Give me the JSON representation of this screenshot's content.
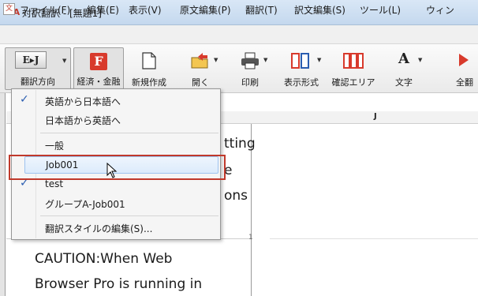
{
  "window": {
    "logo": "TA",
    "title": "対訳翻訳 - [無題1]"
  },
  "menubar": {
    "items": [
      "ファイル(F)",
      "編集(E)",
      "表示(V)",
      "原文編集(P)",
      "翻訳(T)",
      "訳文編集(S)",
      "ツール(L)",
      "ウィン"
    ]
  },
  "toolbar": {
    "direction_icon_text": "E▸J",
    "buttons": [
      {
        "label": "翻訳方向",
        "icon": "translation-direction-icon"
      },
      {
        "label": "経済・金融",
        "icon": "field-dictionary-icon",
        "icon_text": "F"
      },
      {
        "label": "新規作成",
        "icon": "new-document-icon"
      },
      {
        "label": "開く",
        "icon": "open-folder-icon"
      },
      {
        "label": "印刷",
        "icon": "printer-icon"
      },
      {
        "label": "表示形式",
        "icon": "display-format-icon"
      },
      {
        "label": "確認エリア",
        "icon": "check-area-icon"
      },
      {
        "label": "文字",
        "icon": "font-icon",
        "icon_text": "A"
      },
      {
        "label": "全翻",
        "icon": "translate-all-icon"
      }
    ]
  },
  "dropdown": {
    "items": [
      {
        "label": "英語から日本語へ",
        "checked": true
      },
      {
        "label": "日本語から英語へ",
        "checked": false
      },
      {
        "label": "一般",
        "checked": false
      },
      {
        "label": "Job001",
        "checked": false,
        "hovered": true
      },
      {
        "label": "test",
        "checked": true
      },
      {
        "label": "グループA-Job001",
        "checked": false
      },
      {
        "label": "翻訳スタイルの編集(S)...",
        "checked": false
      }
    ],
    "check_mark": "✓"
  },
  "document": {
    "column_header": "J",
    "row_number": "1",
    "partial_lines": [
      "tting",
      "e",
      "ons"
    ],
    "source_lines": [
      "CAUTION:When Web",
      "Browser Pro is running in"
    ]
  },
  "colors": {
    "highlight": "#c0392b",
    "hover_border": "#9ec3ef",
    "check": "#2a5db0"
  }
}
